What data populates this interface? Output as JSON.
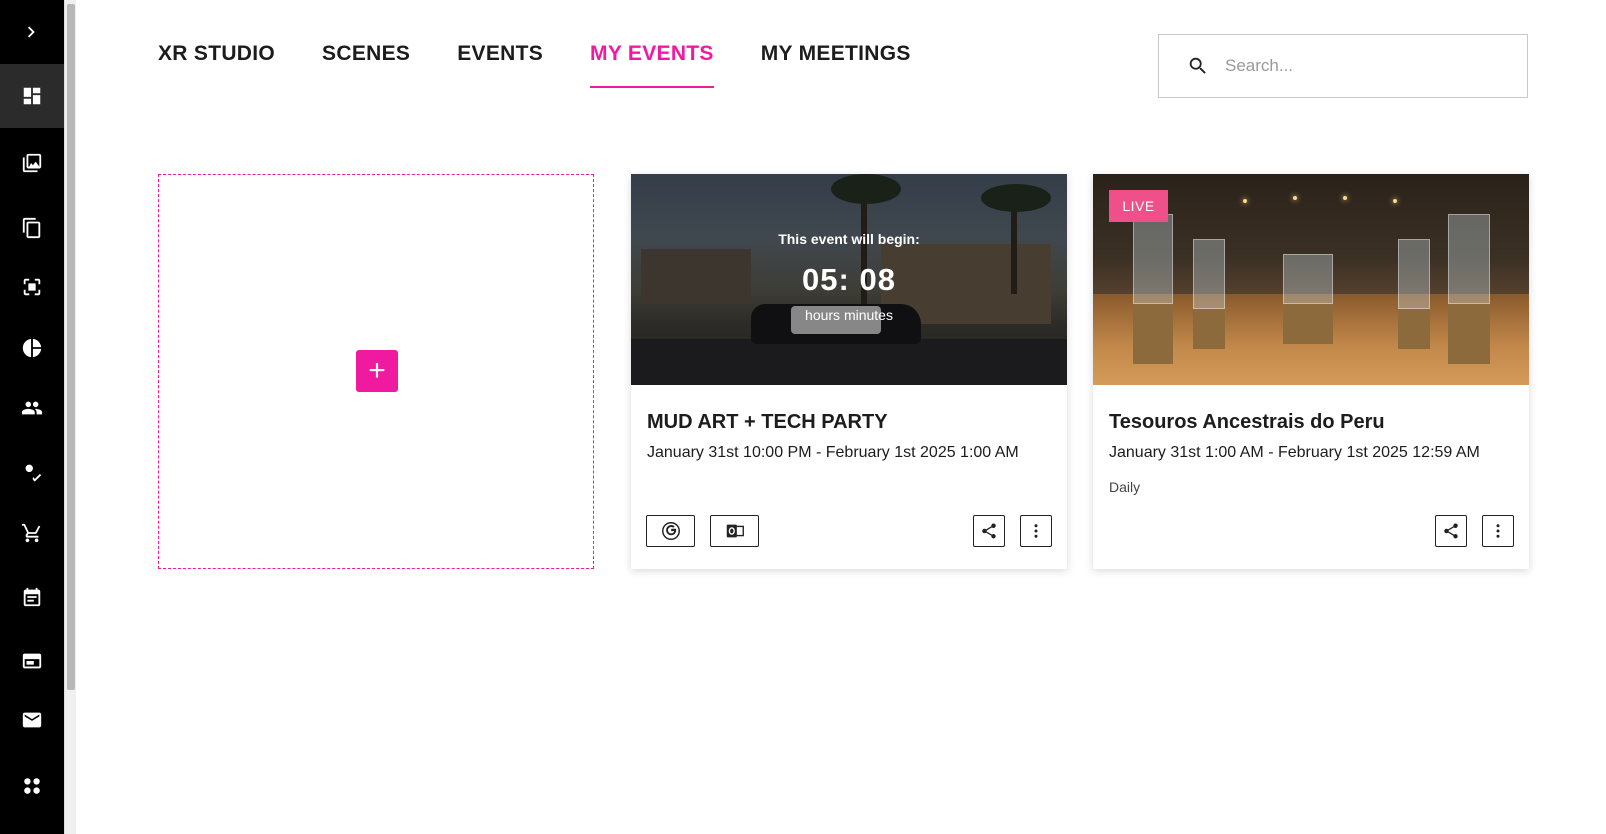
{
  "sidebar": {
    "toggle_icon": "chevron-right-icon",
    "items": [
      {
        "icon": "dashboard-icon",
        "active": true
      },
      {
        "icon": "image-library-icon"
      },
      {
        "icon": "copy-icon"
      },
      {
        "icon": "scan-frame-icon"
      },
      {
        "icon": "pie-chart-icon"
      },
      {
        "icon": "people-icon"
      },
      {
        "icon": "person-check-icon"
      },
      {
        "icon": "cart-icon"
      },
      {
        "icon": "calendar-icon"
      },
      {
        "icon": "browser-window-icon"
      },
      {
        "icon": "mail-icon"
      },
      {
        "icon": "apps-dots-icon"
      }
    ]
  },
  "nav": {
    "tabs": [
      {
        "label": "XR STUDIO"
      },
      {
        "label": "SCENES"
      },
      {
        "label": "EVENTS"
      },
      {
        "label": "MY EVENTS",
        "active": true
      },
      {
        "label": "MY MEETINGS"
      }
    ]
  },
  "search": {
    "placeholder": "Search..."
  },
  "add_card": {
    "icon": "plus-icon",
    "label": "+"
  },
  "events": [
    {
      "title": "MUD ART + TECH PARTY",
      "date": "January 31st 10:00 PM - February 1st 2025 1:00 AM",
      "countdown_label": "This event will begin:",
      "countdown_time": "05: 08",
      "countdown_units": "hours  minutes",
      "actions": [
        "google-calendar-icon",
        "outlook-calendar-icon",
        "share-icon",
        "more-vertical-icon"
      ]
    },
    {
      "title": "Tesouros Ancestrais do Peru",
      "date": "January 31st 1:00 AM - February 1st 2025 12:59 AM",
      "recurrence": "Daily",
      "badge": "LIVE",
      "actions": [
        "share-icon",
        "more-vertical-icon"
      ]
    }
  ],
  "colors": {
    "accent": "#f01aa0",
    "live_badge": "#f0508a",
    "sidebar": "#000000"
  }
}
